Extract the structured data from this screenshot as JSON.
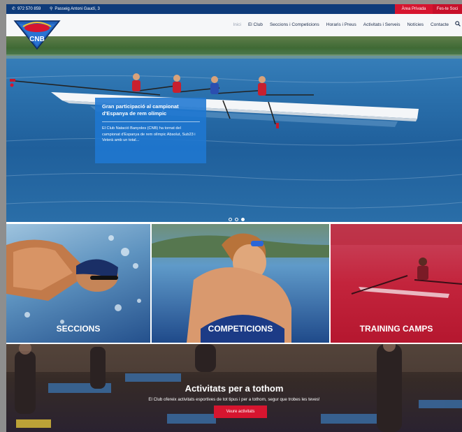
{
  "topbar": {
    "phone": "972 570 859",
    "address": "Passeig Antoni Gaudí, 3",
    "area_privada": "Àrea Privada",
    "fes_te_soci": "Fes-te Soci"
  },
  "logo": {
    "text": "CNB"
  },
  "nav": {
    "items": [
      "Inici",
      "El Club",
      "Seccions i Competicions",
      "Horaris i Preus",
      "Activitats i Serveis",
      "Notícies",
      "Contacte"
    ]
  },
  "hero": {
    "title": "Gran participació al campionat d'Espanya de rem olímpic",
    "text": "El Club Natació Banyoles (CNB) ha tornat del campionat d'Espanya de rem olímpic Absolut, Sub23 i Veterà amb un total..."
  },
  "tiles": [
    "SECCIONS",
    "COMPETICIONS",
    "TRAINING CAMPS"
  ],
  "activitats": {
    "title": "Activitats per a tothom",
    "text": "El Club ofereix activitats esportives de tot tipus i per a tothom, segur que trobes les teves!",
    "button": "Veure activitats"
  },
  "colors": {
    "topbar": "#0e3b7a",
    "accent_red": "#d6152f",
    "caption_blue": "#1f78d2"
  }
}
